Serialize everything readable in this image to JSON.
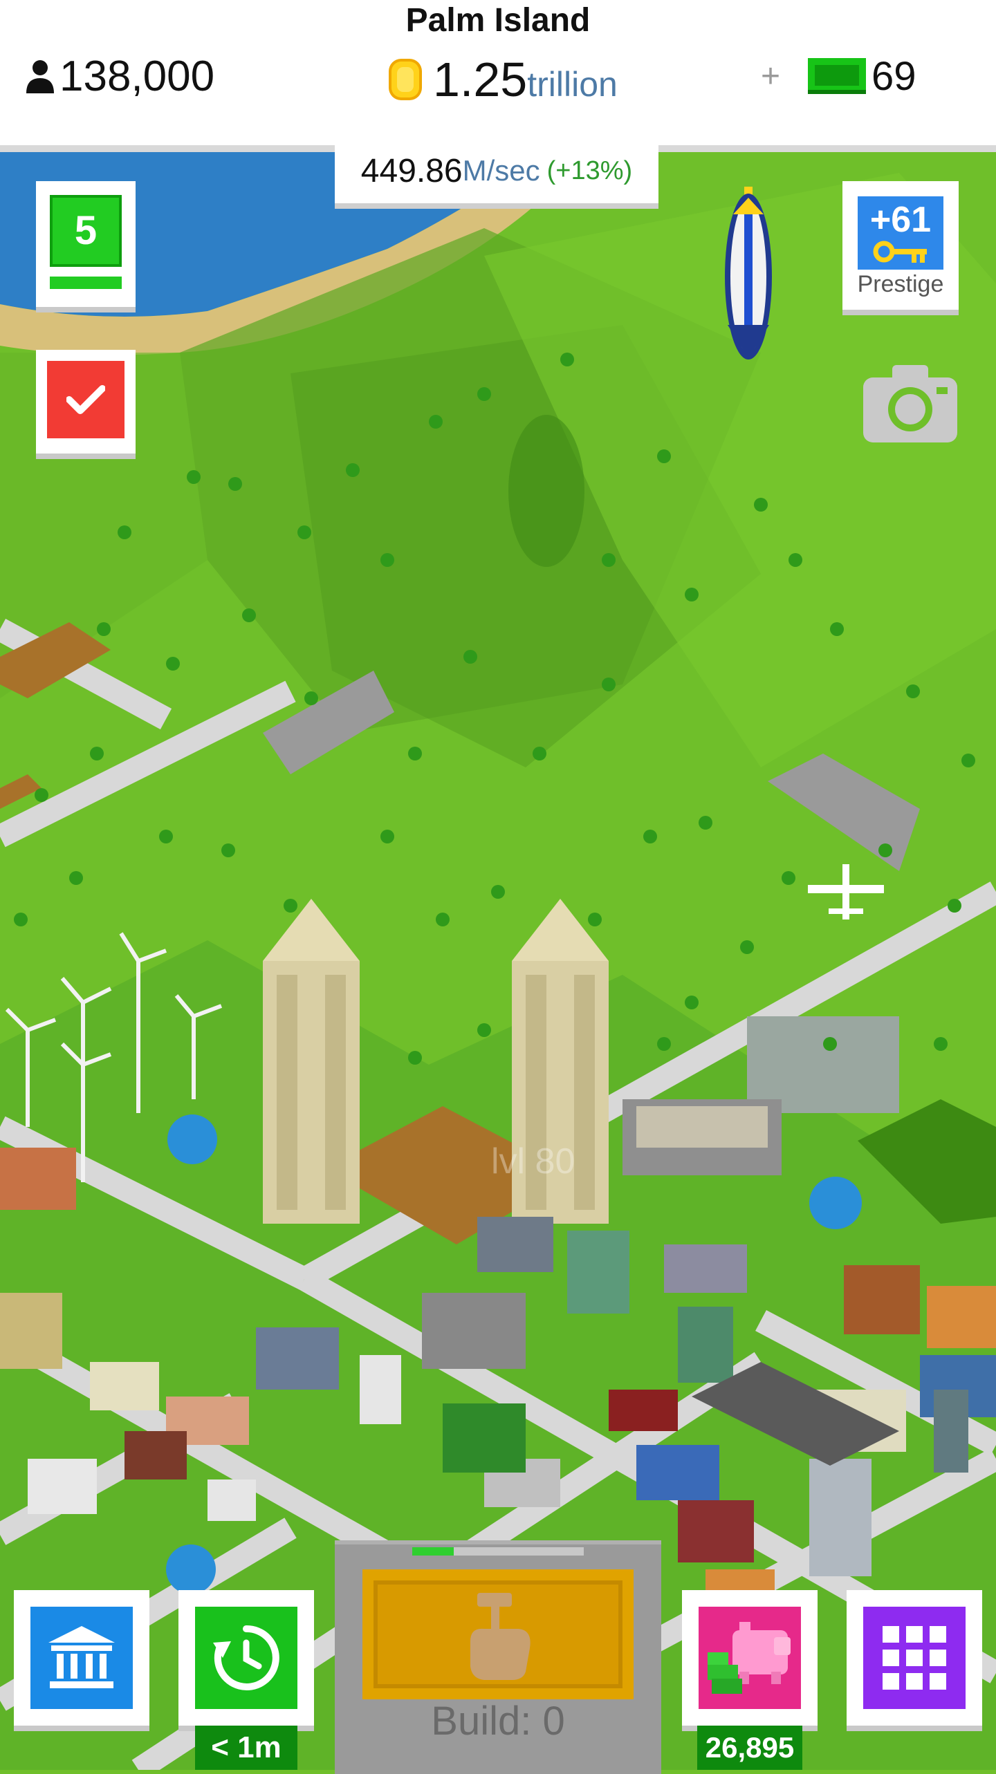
{
  "header": {
    "city_name": "Palm Island",
    "population": "138,000",
    "coins_value": "1.25",
    "coins_unit": "trillion",
    "plus": "+",
    "bux": "69"
  },
  "income": {
    "value": "449.86",
    "unit": "M/sec",
    "bonus": "(+13%)"
  },
  "map": {
    "watermark": "lvl 80"
  },
  "left_panel": {
    "level": "5"
  },
  "right_panel": {
    "prestige_value": "+61",
    "prestige_label": "Prestige"
  },
  "bottom": {
    "timewarp_label": "< 1m",
    "build_label": "Build: 0",
    "build_progress": 0.24,
    "piggybank_value": "26,895"
  },
  "icons": {
    "population": "person-icon",
    "coin": "coin-icon",
    "bux": "bux-banknote-icon",
    "camera": "camera-icon",
    "bank": "bank-icon",
    "timewarp": "clock-arrow-icon",
    "piggy": "piggy-bank-icon",
    "menu": "grid-menu-icon",
    "build": "hammer-hand-icon",
    "checkmark": "checkmark-icon",
    "key": "key-icon",
    "blimp": "blimp-icon",
    "plane": "airplane-icon"
  },
  "colors": {
    "grass": "#6fbf2a",
    "ocean": "#2e7fc6",
    "road": "#d8d8d8",
    "accent_blue": "#4d7aa6",
    "accent_green": "#19c11c",
    "bank_blue": "#1a8ae6",
    "pig_pink": "#e6298a",
    "menu_purple": "#8e2bf0",
    "task_red": "#f23b34",
    "build_gold": "#d89a00"
  }
}
